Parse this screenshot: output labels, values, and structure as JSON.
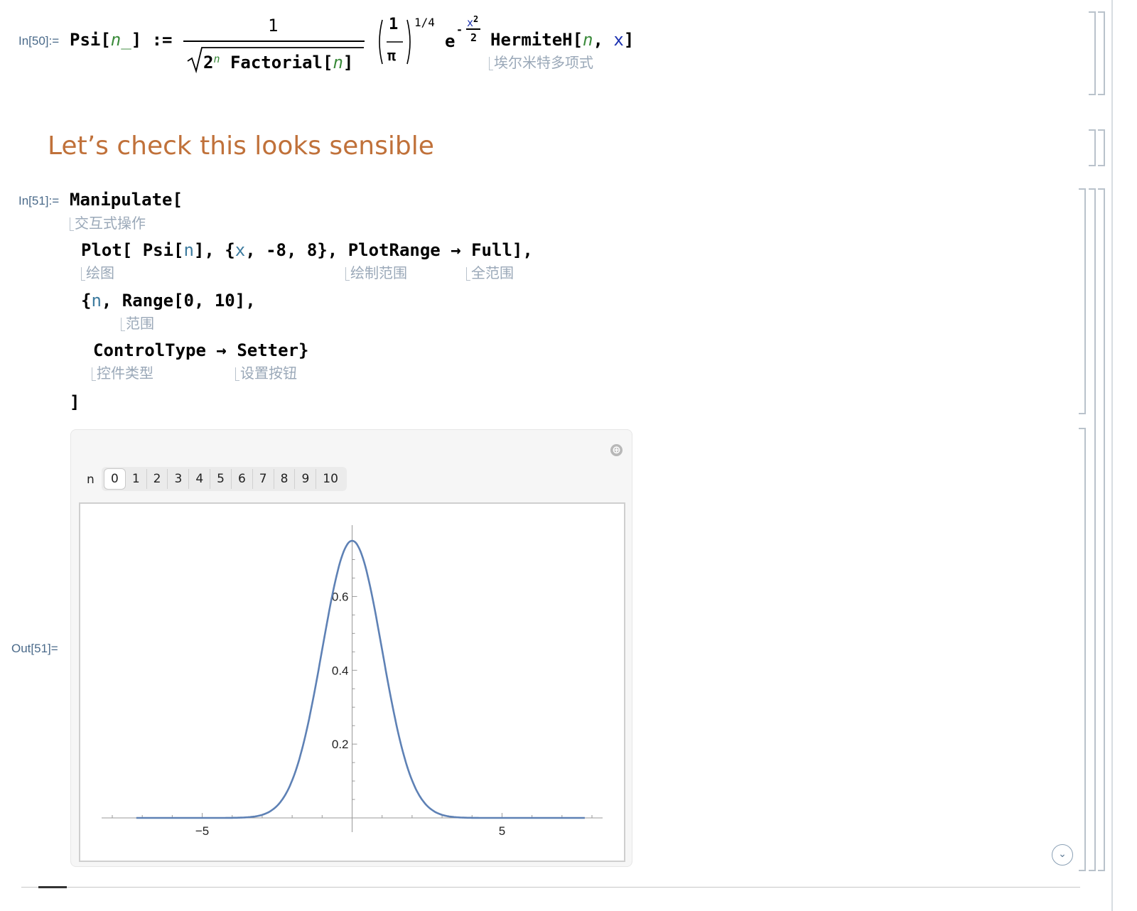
{
  "cell1": {
    "label": "In[50]:=",
    "lhs_head": "Psi[",
    "lhs_pattern": "n_",
    "lhs_close": "]",
    "assign": ":=",
    "numerator": "1",
    "den_base": "2",
    "den_exp": "n",
    "den_factorial": "Factorial[",
    "den_factorial_arg": "n",
    "den_factorial_close": "]",
    "frac_num": "1",
    "frac_den": "π",
    "power": "1/4",
    "exp_base": "e",
    "exp_sign": "-",
    "exp_num_var": "x",
    "exp_num_pow": "2",
    "exp_den": "2",
    "hermite_head": "HermiteH[",
    "hermite_arg1": "n",
    "hermite_sep": ", ",
    "hermite_arg2": "x",
    "hermite_close": "]",
    "hermite_hint": "埃尔米特多项式"
  },
  "heading": "Let’s check this looks sensible",
  "cell2": {
    "label": "In[51]:=",
    "line1": "Manipulate[",
    "line1_hint": "交互式操作",
    "line2_plot": "Plot[",
    "line2_psi": " Psi[",
    "line2_n": "n",
    "line2_mid": "], {",
    "line2_x": "x",
    "line2_rest": ", -8, 8}, ",
    "line2_plotrange": "PlotRange",
    "line2_arrow": " → ",
    "line2_full": "Full],",
    "hint_plot": "绘图",
    "hint_plotrange": "绘制范围",
    "hint_full": "全范围",
    "line3_open": "{",
    "line3_n": "n",
    "line3_rest": ", Range[0, 10],",
    "hint_range": "范围",
    "line4_ct": "ControlType",
    "line4_arrow": " → ",
    "line4_setter": "Setter}",
    "hint_controltype": "控件类型",
    "hint_setter": "设置按钮",
    "line5": "]"
  },
  "output": {
    "label": "Out[51]=",
    "control_name": "n",
    "setter_options": [
      "0",
      "1",
      "2",
      "3",
      "4",
      "5",
      "6",
      "7",
      "8",
      "9",
      "10"
    ],
    "selected": "0",
    "plus_icon": "⊕",
    "scroll_icon": "⌄"
  },
  "chart_data": {
    "type": "line",
    "title": "",
    "xlabel": "",
    "ylabel": "",
    "xlim": [
      -8,
      8
    ],
    "ylim": [
      0,
      0.751
    ],
    "x_ticks": [
      -5,
      5
    ],
    "x_tick_labels": [
      "−5",
      "5"
    ],
    "y_ticks": [
      0.2,
      0.4,
      0.6
    ],
    "y_tick_labels": [
      "0.2",
      "0.4",
      "0.6"
    ],
    "series": [
      {
        "color": "#5e81b5",
        "x": [
          -8,
          -7,
          -6,
          -5,
          -4,
          -3.5,
          -3,
          -2.5,
          -2,
          -1.75,
          -1.5,
          -1.25,
          -1,
          -0.75,
          -0.5,
          -0.25,
          0,
          0.25,
          0.5,
          0.75,
          1,
          1.25,
          1.5,
          1.75,
          2,
          2.5,
          3,
          3.5,
          4,
          5,
          6,
          7,
          8
        ],
        "y": [
          0,
          0,
          0,
          0,
          0.0003,
          0.0016,
          0.0084,
          0.033,
          0.1019,
          0.1617,
          0.2442,
          0.3433,
          0.4556,
          0.5682,
          0.6631,
          0.7278,
          0.7511,
          0.7278,
          0.6631,
          0.5682,
          0.4556,
          0.3433,
          0.2442,
          0.1617,
          0.1019,
          0.033,
          0.0084,
          0.0016,
          0.0003,
          0,
          0,
          0,
          0
        ]
      }
    ],
    "grid": false,
    "legend": "none"
  }
}
